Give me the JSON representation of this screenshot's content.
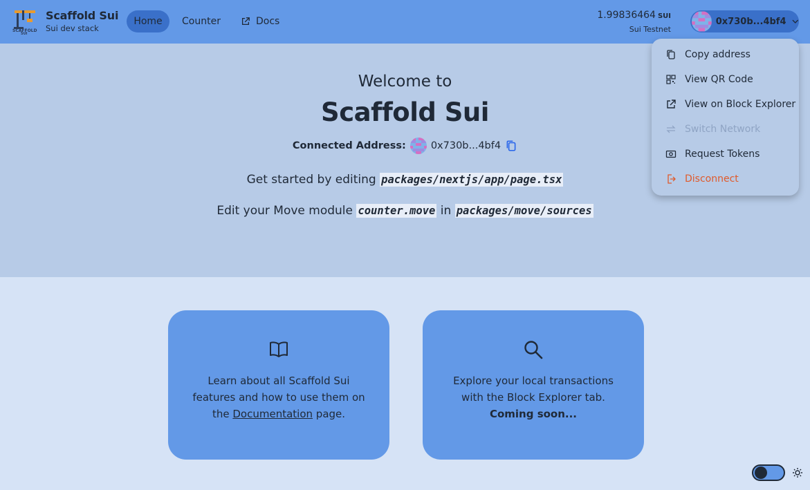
{
  "header": {
    "brand_title": "Scaffold Sui",
    "brand_subtitle": "Sui dev stack",
    "nav": {
      "home": "Home",
      "counter": "Counter",
      "docs": "Docs"
    },
    "balance": "1.99836464",
    "balance_unit": "SUI",
    "network": "Sui Testnet",
    "account_address": "0x730b...4bf4"
  },
  "hero": {
    "welcome": "Welcome to",
    "title": "Scaffold Sui",
    "connected_label": "Connected Address:",
    "connected_address": "0x730b...4bf4",
    "line1_prefix": "Get started by editing",
    "line1_code": "packages/nextjs/app/page.tsx",
    "line2_prefix": "Edit your Move module",
    "line2_code1": "counter.move",
    "line2_mid": "in",
    "line2_code2": "packages/move/sources"
  },
  "cards": {
    "docs": {
      "text_before": "Learn about all Scaffold Sui features and how to use them on the",
      "link": "Documentation",
      "text_after": "page."
    },
    "explorer": {
      "text": "Explore your local transactions with the Block Explorer tab.",
      "bold": "Coming soon..."
    }
  },
  "dropdown": {
    "copy_address": "Copy address",
    "view_qr": "View QR Code",
    "view_explorer": "View on Block Explorer",
    "switch_network": "Switch Network",
    "request_tokens": "Request Tokens",
    "disconnect": "Disconnect"
  },
  "colors": {
    "header_bg": "#6399e7",
    "hero_bg": "#b7cbe7",
    "page_bg": "#d6e3f6",
    "active_nav": "#3a70c9",
    "danger": "#e05a2b"
  }
}
